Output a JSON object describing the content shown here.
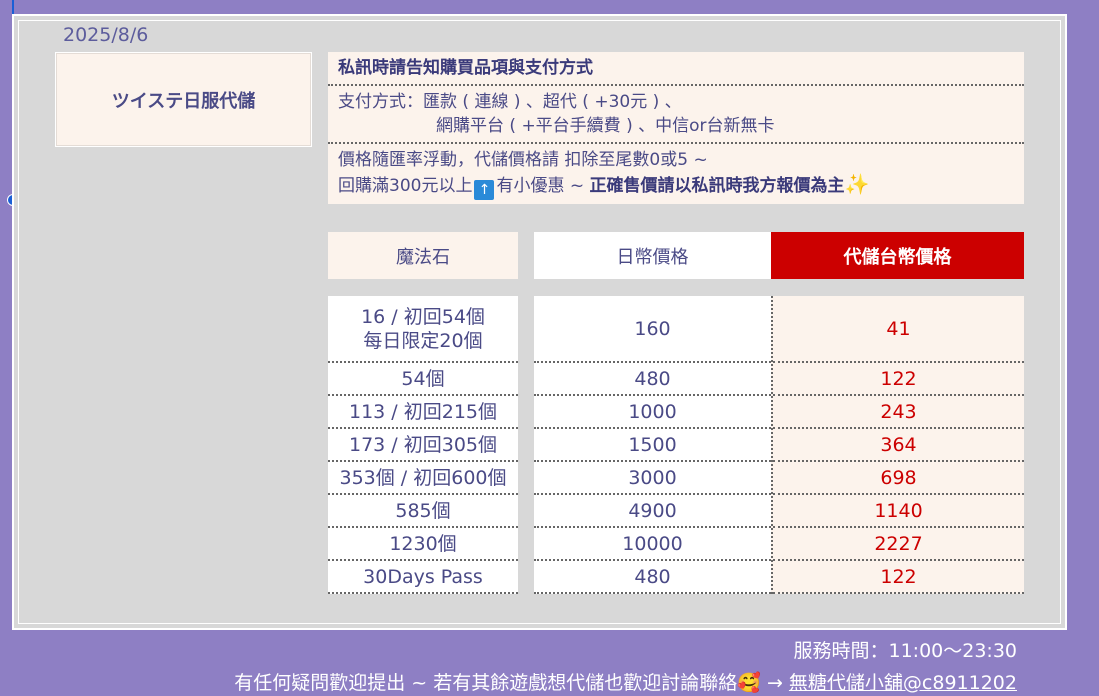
{
  "date": "2025/8/6",
  "brand": "ツイステ日服代儲",
  "info": {
    "title": "私訊時請告知購買品項與支付方式",
    "payment_line1": "支付方式：匯款 ( 連線 ) 、超代 ( +30元 ) 、",
    "payment_line2": "網購平台 ( +平台手續費 ) 、中信or台新無卡",
    "price_line1": "價格隨匯率浮動，代儲價格請 扣除至尾數0或5 ~",
    "price_line2_prefix": "回購滿300元以上",
    "price_line2_suffix": "有小優惠 ~ ",
    "price_line2_strong": "正確售價請以私訊時我方報價為主",
    "arrow_icon": "↑",
    "sparkle_icon": "✨"
  },
  "table": {
    "headers": [
      "魔法石",
      "日幣價格",
      "代儲台幣價格"
    ],
    "rows": [
      {
        "stone_line1": "16 / 初回54個",
        "stone_line2": "每日限定20個",
        "jpy": "160",
        "twd": "41"
      },
      {
        "stone_line1": "54個",
        "stone_line2": "",
        "jpy": "480",
        "twd": "122"
      },
      {
        "stone_line1": "113 / 初回215個",
        "stone_line2": "",
        "jpy": "1000",
        "twd": "243"
      },
      {
        "stone_line1": "173 / 初回305個",
        "stone_line2": "",
        "jpy": "1500",
        "twd": "364"
      },
      {
        "stone_line1": "353個 / 初回600個",
        "stone_line2": "",
        "jpy": "3000",
        "twd": "698"
      },
      {
        "stone_line1": "585個",
        "stone_line2": "",
        "jpy": "4900",
        "twd": "1140"
      },
      {
        "stone_line1": "1230個",
        "stone_line2": "",
        "jpy": "10000",
        "twd": "2227"
      },
      {
        "stone_line1": "30Days Pass",
        "stone_line2": "",
        "jpy": "480",
        "twd": "122"
      }
    ]
  },
  "footer": {
    "hours": "服務時間：11:00～23:30",
    "contact_text": "有任何疑問歡迎提出 ~ 若有其餘遊戲想代儲也歡迎討論聯絡",
    "contact_emoji": "🥰",
    "contact_arrow": " → ",
    "shop": "無糖代儲小舖@c8911202"
  },
  "colors": {
    "background": "#8e7fc4",
    "panel": "#d8d8d8",
    "accent_red": "#cc0000",
    "text": "#4a4a86"
  }
}
